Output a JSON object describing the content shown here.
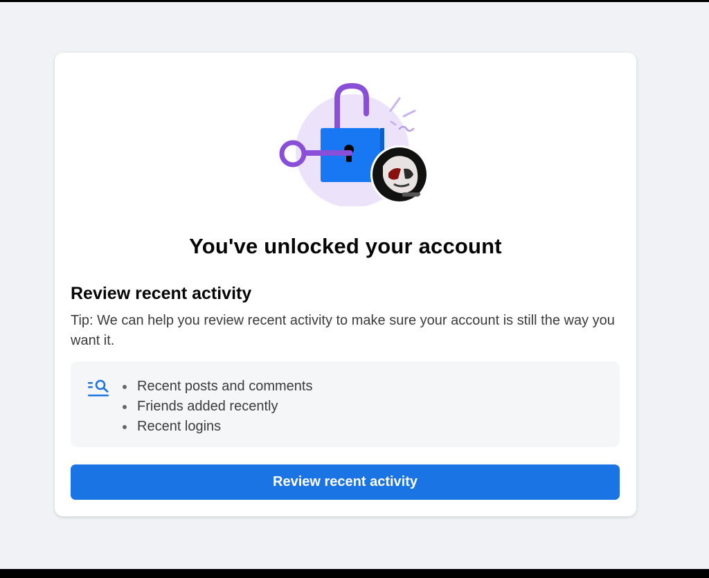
{
  "dialog": {
    "title": "You've unlocked your account",
    "section_heading": "Review recent activity",
    "tip": "Tip: We can help you review recent activity to make sure your account is still the way you want it.",
    "activity_items": [
      "Recent posts and comments",
      "Friends added recently",
      "Recent logins"
    ],
    "button_label": "Review recent activity"
  },
  "icons": {
    "illustration": "unlocked-padlock-with-key",
    "activity": "list-search-icon"
  },
  "colors": {
    "page_background": "#f0f2f5",
    "card_background": "#ffffff",
    "primary_button": "#1b74e4",
    "lock_body": "#1877f2",
    "lock_accent": "#8a4fd8",
    "illustration_circle": "#ece3fb",
    "text_primary": "#050505",
    "text_secondary": "#3a3b3c"
  }
}
